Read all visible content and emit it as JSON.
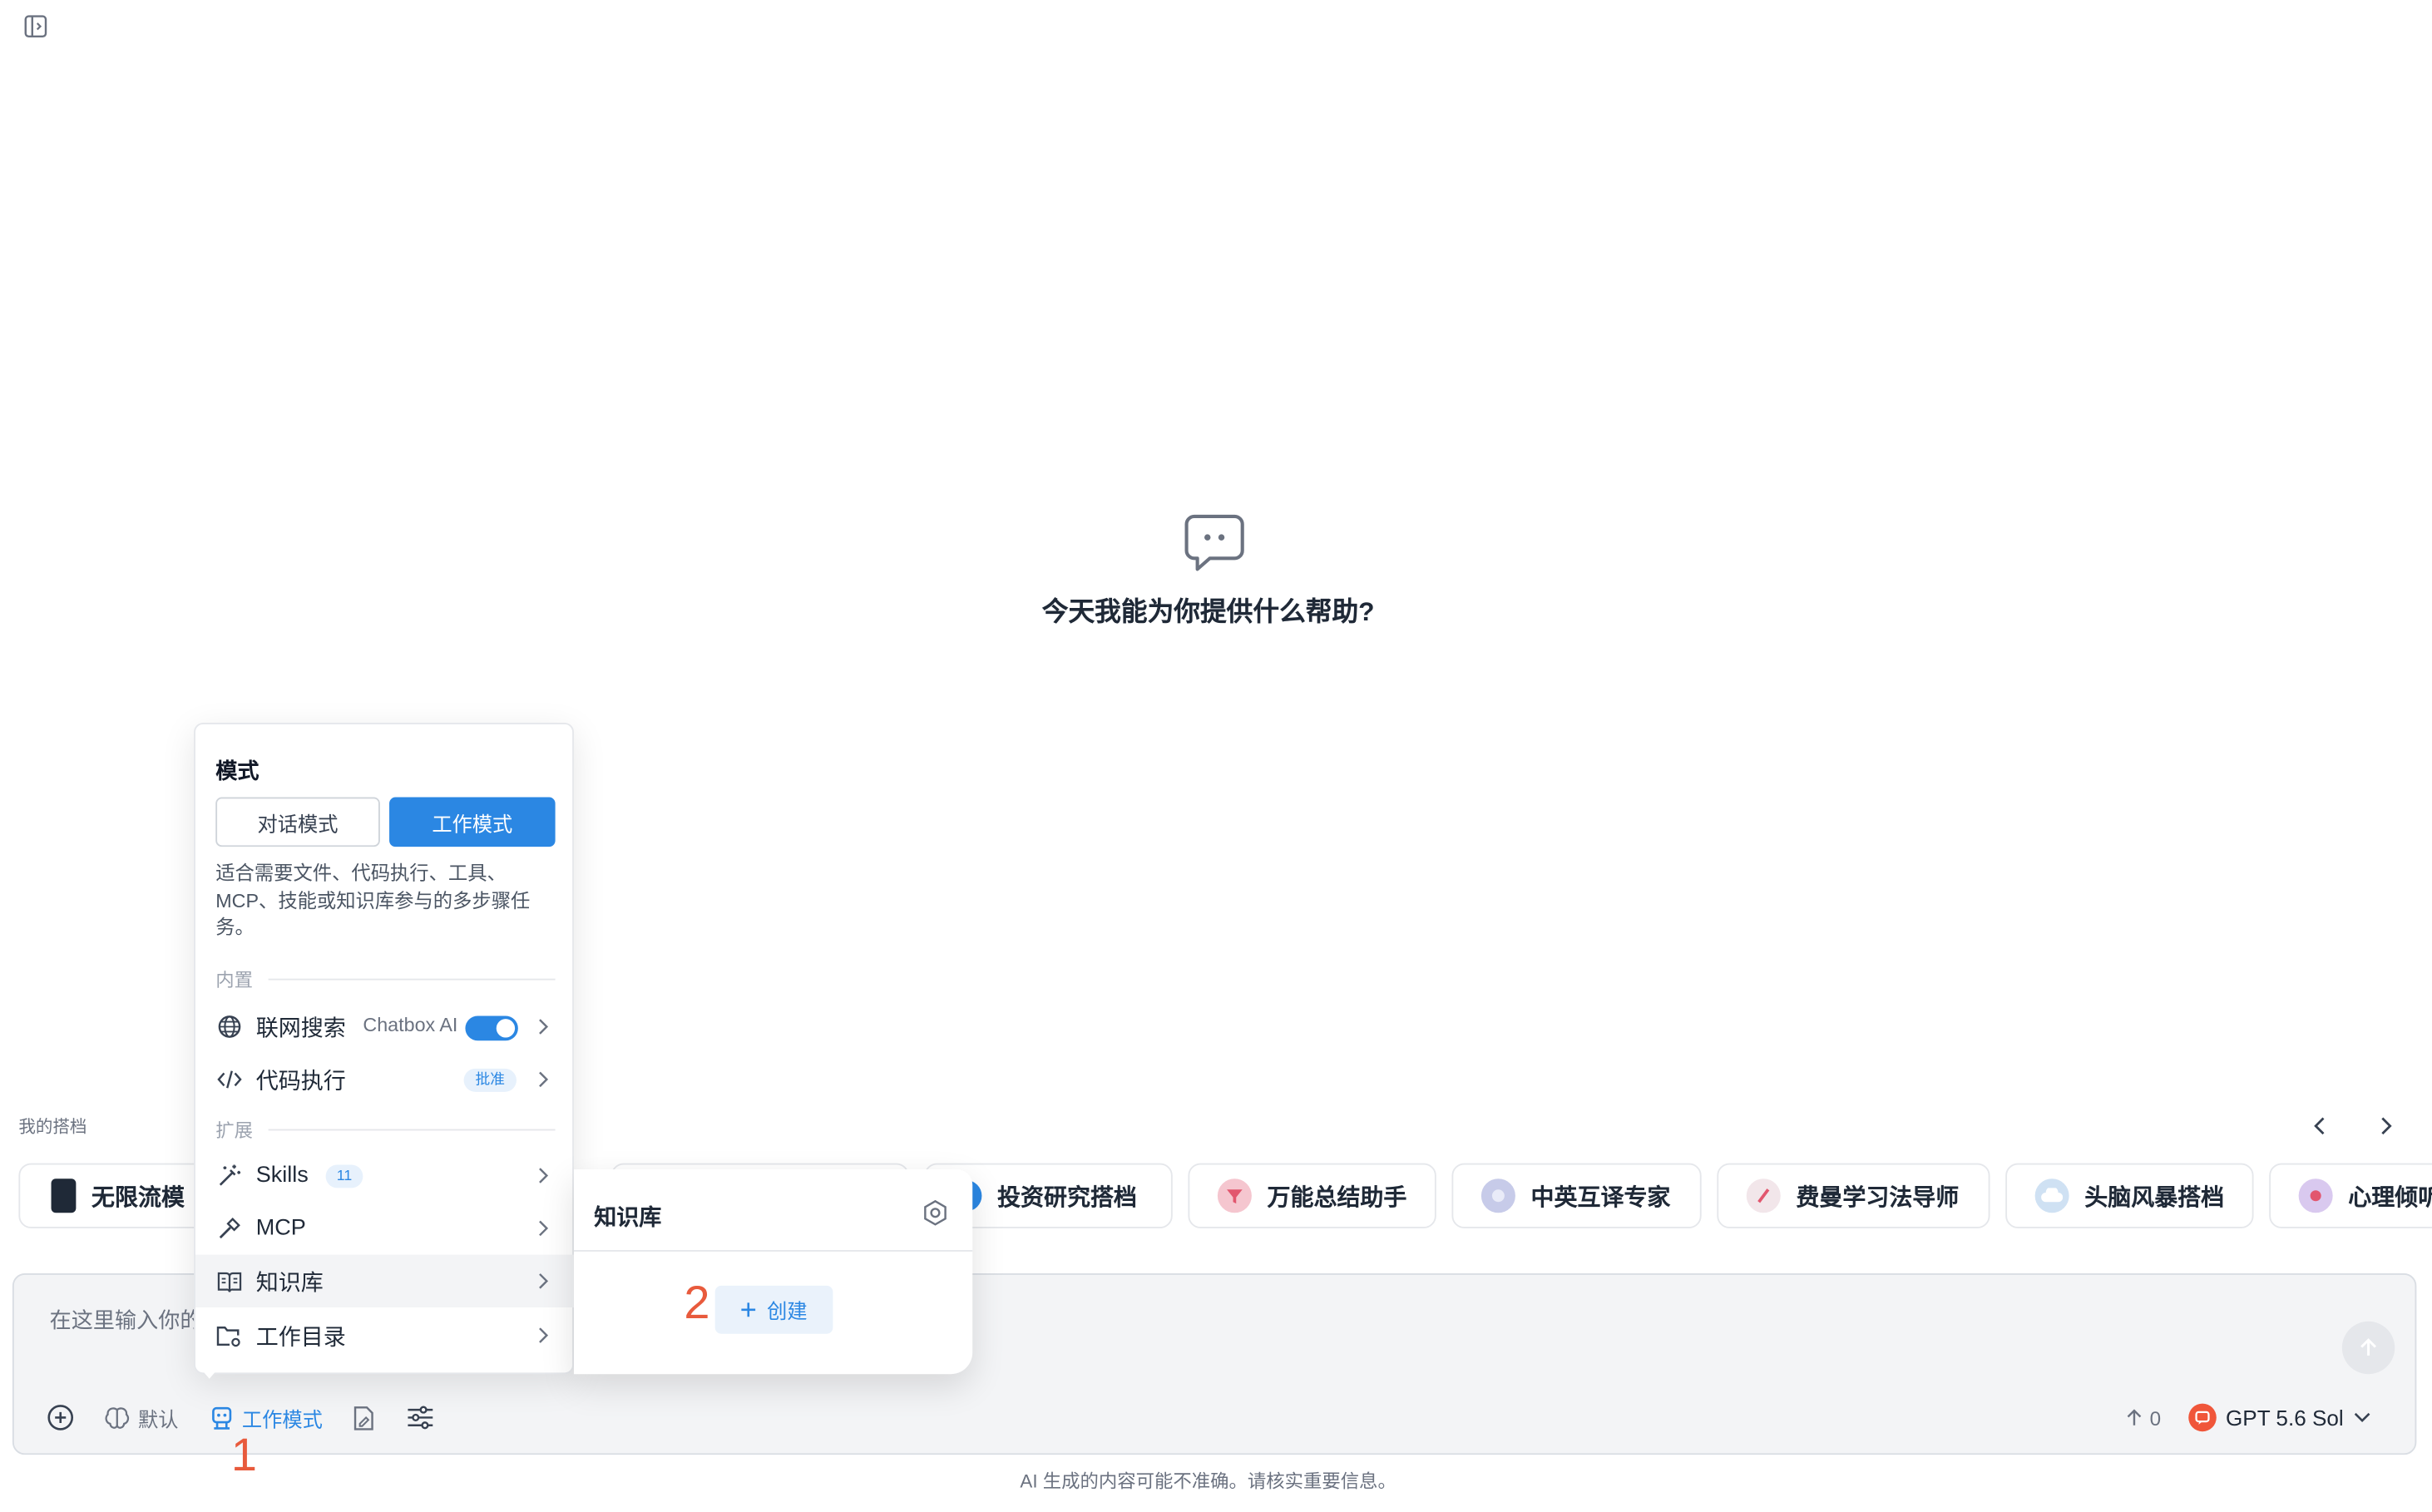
{
  "welcome": {
    "title": "今天我能为你提供什么帮助?"
  },
  "partners": {
    "label": "我的搭档",
    "items": [
      {
        "name": "无限流模",
        "avatar_color": "#1f2937"
      },
      {
        "name": "投资研究搭档",
        "avatar_color": "#2b87e3"
      },
      {
        "name": "万能总结助手",
        "avatar_color": "#f5c6cf"
      },
      {
        "name": "中英互译专家",
        "avatar_color": "#c7cbe9"
      },
      {
        "name": "费曼学习法导师",
        "avatar_color": "#f2e6ea"
      },
      {
        "name": "头脑风暴搭档",
        "avatar_color": "#cfe1f3"
      },
      {
        "name": "心理倾听",
        "avatar_color": "#d9c9ef"
      }
    ]
  },
  "input": {
    "placeholder": "在这里输入你的问题..."
  },
  "toolbar": {
    "default_label": "默认",
    "work_mode_label": "工作模式",
    "token_count": "0",
    "model": "GPT 5.6 Sol"
  },
  "disclaimer": "AI 生成的内容可能不准确。请核实重要信息。",
  "mode_menu": {
    "title": "模式",
    "chat_mode": "对话模式",
    "work_mode": "工作模式",
    "description": "适合需要文件、代码执行、工具、MCP、技能或知识库参与的多步骤任务。",
    "builtin_label": "内置",
    "web_search": {
      "label": "联网搜索",
      "provider": "Chatbox AI",
      "enabled": true
    },
    "code_exec": {
      "label": "代码执行",
      "badge": "批准"
    },
    "extensions_label": "扩展",
    "skills": {
      "label": "Skills",
      "count": "11"
    },
    "mcp": {
      "label": "MCP"
    },
    "knowledge": {
      "label": "知识库"
    },
    "workdir": {
      "label": "工作目录"
    }
  },
  "kb_menu": {
    "title": "知识库",
    "create_label": "创建"
  },
  "annotations": {
    "one": "1",
    "two": "2"
  },
  "colors": {
    "accent": "#2b87e3",
    "annotation": "#e85a3c",
    "model_icon": "#f0563a"
  }
}
